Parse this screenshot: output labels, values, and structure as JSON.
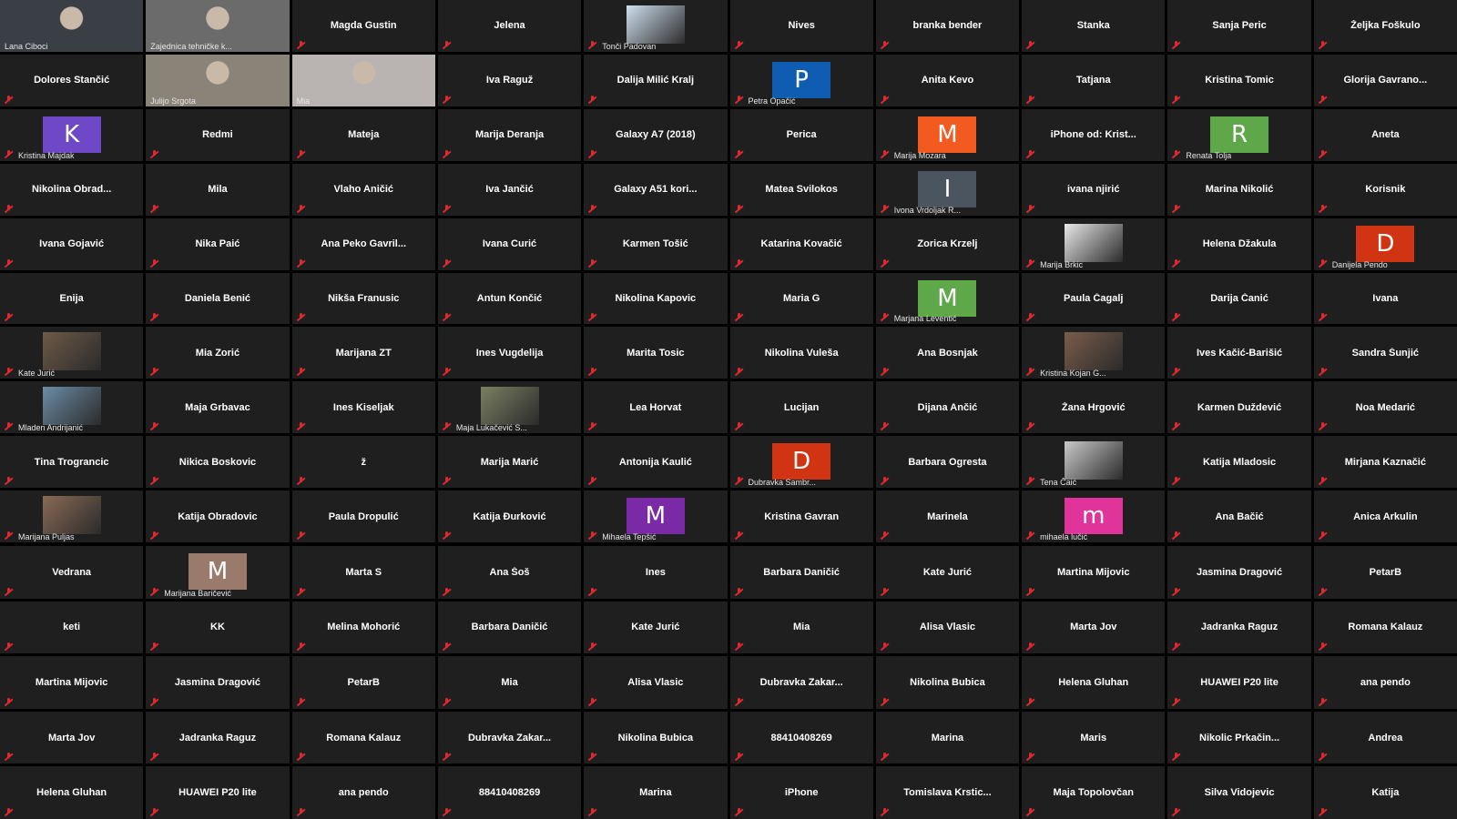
{
  "active_speaker_color": "#d5e87a",
  "muted_icon_color": "#e0282e",
  "tile_color": "#1f1f1f",
  "gallery_pages": [
    [
      {
        "type": "video",
        "caption": "Lana Ciboci",
        "bg": "#3a3f45",
        "active": true
      },
      {
        "type": "video",
        "caption": "Zajednica tehničke k...",
        "bg": "#6b6b6b"
      },
      {
        "type": "name",
        "label": "Magda Gustin"
      },
      {
        "type": "name",
        "label": "Jelena"
      },
      {
        "type": "thumb",
        "caption": "Tonči Padovan",
        "thumb": "world-map-image",
        "bg": "#cfe0ef"
      },
      {
        "type": "name",
        "label": "Nives"
      },
      {
        "type": "name",
        "label": "branka bender"
      },
      {
        "type": "name",
        "label": "Stanka"
      },
      {
        "type": "name",
        "label": "Sanja Peric"
      },
      {
        "type": "name",
        "label": "Željka Foškulo"
      },
      {
        "type": "name",
        "label": "Dolores Stančić"
      },
      {
        "type": "video",
        "caption": "Julijo Srgota",
        "bg": "#8a8378"
      },
      {
        "type": "video",
        "caption": "Mia",
        "bg": "#b9b4b1"
      },
      {
        "type": "name",
        "label": "Iva Raguž"
      },
      {
        "type": "name",
        "label": "Dalija Milić Kralj"
      },
      {
        "type": "avatar",
        "letter": "P",
        "color": "#0e5db3",
        "caption": "Petra Opačić"
      },
      {
        "type": "name",
        "label": "Anita Kevo"
      },
      {
        "type": "name",
        "label": "Tatjana"
      },
      {
        "type": "name",
        "label": "Kristina Tomic"
      },
      {
        "type": "name",
        "label": "Glorija  Gavrano..."
      },
      {
        "type": "avatar",
        "letter": "K",
        "color": "#6f48c7",
        "caption": "Kristina Majdak"
      },
      {
        "type": "name",
        "label": "Redmi"
      },
      {
        "type": "name",
        "label": "Mateja"
      },
      {
        "type": "name",
        "label": "Marija Deranja"
      },
      {
        "type": "name",
        "label": "Galaxy A7 (2018)"
      },
      {
        "type": "name",
        "label": "Perica"
      },
      {
        "type": "avatar",
        "letter": "M",
        "color": "#f25a1f",
        "caption": "Marija Mozara"
      },
      {
        "type": "name",
        "label": "iPhone  od:  Krist..."
      },
      {
        "type": "avatar",
        "letter": "R",
        "color": "#5fa84a",
        "caption": "Renata Tolja"
      },
      {
        "type": "name",
        "label": "Aneta"
      },
      {
        "type": "name",
        "label": "Nikolina  Obrad..."
      },
      {
        "type": "name",
        "label": "Mila"
      },
      {
        "type": "name",
        "label": "Vlaho Aničić"
      },
      {
        "type": "name",
        "label": "Iva Jančić"
      },
      {
        "type": "name",
        "label": "Galaxy  A51  kori..."
      },
      {
        "type": "name",
        "label": "Matea Svilokos"
      },
      {
        "type": "avatar",
        "letter": "I",
        "color": "#4a5560",
        "caption": "Ivona Vrdoljak R..."
      },
      {
        "type": "name",
        "label": "ivana njirić"
      },
      {
        "type": "name",
        "label": "Marina Nikolić"
      },
      {
        "type": "name",
        "label": "Korisnik"
      },
      {
        "type": "name",
        "label": "Ivana Gojavić"
      },
      {
        "type": "name",
        "label": "Nika Paić"
      },
      {
        "type": "name",
        "label": "Ana  Peko  Gavril..."
      },
      {
        "type": "name",
        "label": "Ivana Curić"
      },
      {
        "type": "name",
        "label": "Karmen Tošić"
      },
      {
        "type": "name",
        "label": "Katarina Kovačić"
      },
      {
        "type": "name",
        "label": "Zorica Krzelj"
      },
      {
        "type": "thumb",
        "caption": "Marija Brkic",
        "thumb": "cartoon-sketch-image",
        "bg": "#e8e8e8"
      },
      {
        "type": "name",
        "label": "Helena Džakula"
      },
      {
        "type": "avatar",
        "letter": "D",
        "color": "#d03412",
        "caption": "Danijela Pendo"
      },
      {
        "type": "name",
        "label": "Enija"
      },
      {
        "type": "name",
        "label": "Daniela Benić"
      },
      {
        "type": "name",
        "label": "Nikša Franusic"
      },
      {
        "type": "name",
        "label": "Antun Končić"
      },
      {
        "type": "name",
        "label": "Nikolina Kapovic"
      },
      {
        "type": "name",
        "label": "Maria G"
      },
      {
        "type": "avatar",
        "letter": "M",
        "color": "#5fa84a",
        "caption": "Marjana Leventić"
      },
      {
        "type": "name",
        "label": "Paula Čagalj"
      },
      {
        "type": "name",
        "label": "Darija Čanić"
      },
      {
        "type": "name",
        "label": "Ivana"
      },
      {
        "type": "thumb",
        "caption": "Kate Jurić",
        "thumb": "group-photo-image",
        "bg": "#6e5a47"
      },
      {
        "type": "name",
        "label": "Mia Zorić"
      },
      {
        "type": "name",
        "label": "Marijana ZT"
      },
      {
        "type": "name",
        "label": "Ines Vugdelija"
      },
      {
        "type": "name",
        "label": "Marita Tosic"
      },
      {
        "type": "name",
        "label": "Nikolina Vuleša"
      },
      {
        "type": "name",
        "label": "Ana Bosnjak"
      },
      {
        "type": "thumb",
        "caption": "Kristina Kojan G...",
        "thumb": "portrait-photo-image",
        "bg": "#7a5d4a"
      },
      {
        "type": "name",
        "label": "Ives Kačić-Barišić"
      },
      {
        "type": "name",
        "label": "Sandra Šunjić"
      },
      {
        "type": "thumb",
        "caption": "Mladen Andrijanić",
        "thumb": "seaside-photo-image",
        "bg": "#6c8ca6"
      },
      {
        "type": "name",
        "label": "Maja Grbavac"
      },
      {
        "type": "name",
        "label": "Ines Kiseljak"
      },
      {
        "type": "thumb",
        "caption": "Maja Lukačević S...",
        "thumb": "forest-road-image",
        "bg": "#7b8061"
      },
      {
        "type": "name",
        "label": "Lea Horvat"
      },
      {
        "type": "name",
        "label": "Lucijan"
      },
      {
        "type": "name",
        "label": "Dijana Ančić"
      },
      {
        "type": "name",
        "label": "Žana Hrgović"
      },
      {
        "type": "name",
        "label": "Karmen Duždević"
      },
      {
        "type": "name",
        "label": "Noa Medarić"
      },
      {
        "type": "name",
        "label": "Tina Trograncic"
      },
      {
        "type": "name",
        "label": "Nikica Boskovic"
      },
      {
        "type": "name",
        "label": "ž"
      },
      {
        "type": "name",
        "label": "Marija Marić"
      },
      {
        "type": "name",
        "label": "Antonija Kaulić"
      },
      {
        "type": "avatar",
        "letter": "D",
        "color": "#d03412",
        "caption": "Dubravka Sambr..."
      },
      {
        "type": "name",
        "label": "Barbara Ogresta"
      },
      {
        "type": "thumb",
        "caption": "Tena Čaić",
        "thumb": "portrait-photo-image",
        "bg": "#c9c9c9"
      },
      {
        "type": "name",
        "label": "Katija Mladosic"
      },
      {
        "type": "name",
        "label": "Mirjana Kaznačić"
      },
      {
        "type": "thumb",
        "caption": "Marijana Puljas",
        "thumb": "portrait-photo-image",
        "bg": "#8a6a55"
      },
      {
        "type": "name",
        "label": "Katija Obradovic"
      },
      {
        "type": "name",
        "label": "Paula Dropulić"
      },
      {
        "type": "name",
        "label": "Katija Đurković"
      },
      {
        "type": "avatar",
        "letter": "M",
        "color": "#7a2aa6",
        "caption": "Mihaela Tepšić"
      },
      {
        "type": "name",
        "label": "Kristina Gavran"
      },
      {
        "type": "name",
        "label": "Marinela"
      },
      {
        "type": "avatar",
        "letter": "m",
        "color": "#e0349a",
        "caption": "mihaela lučić"
      },
      {
        "type": "name",
        "label": "Ana Bačić"
      },
      {
        "type": "name",
        "label": "Anica Arkulin"
      }
    ],
    [
      {
        "type": "name",
        "label": "Vedrana"
      },
      {
        "type": "avatar",
        "letter": "M",
        "color": "#9a7a6a",
        "caption": "Marijana Baričević"
      },
      {
        "type": "name",
        "label": "Marta S"
      },
      {
        "type": "name",
        "label": "Ana Šoš"
      },
      {
        "type": "name",
        "label": "Ines"
      },
      {
        "type": "name",
        "label": "Barbara Daničić"
      },
      {
        "type": "name",
        "label": "Kate Jurić"
      },
      {
        "type": "name",
        "label": "Martina Mijovic"
      },
      {
        "type": "name",
        "label": "Jasmina Dragović"
      },
      {
        "type": "name",
        "label": "PetarB"
      },
      {
        "type": "name",
        "label": "keti"
      },
      {
        "type": "name",
        "label": "KK"
      },
      {
        "type": "name",
        "label": "Melina Mohorić"
      },
      {
        "type": "name",
        "label": "Barbara Daničić"
      },
      {
        "type": "name",
        "label": "Kate Jurić"
      },
      {
        "type": "name",
        "label": "Mia"
      },
      {
        "type": "name",
        "label": "Alisa Vlasic"
      },
      {
        "type": "name",
        "label": "Marta Jov"
      },
      {
        "type": "name",
        "label": "Jadranka Raguz"
      },
      {
        "type": "name",
        "label": "Romana Kalauz"
      },
      {
        "type": "name",
        "label": "Martina Mijovic"
      },
      {
        "type": "name",
        "label": "Jasmina Dragović"
      },
      {
        "type": "name",
        "label": "PetarB"
      },
      {
        "type": "name",
        "label": "Mia"
      },
      {
        "type": "name",
        "label": "Alisa Vlasic"
      },
      {
        "type": "name",
        "label": "Dubravka  Zakar..."
      },
      {
        "type": "name",
        "label": "Nikolina Bubica"
      },
      {
        "type": "name",
        "label": "Helena Gluhan"
      },
      {
        "type": "name",
        "label": "HUAWEI P20 lite"
      },
      {
        "type": "name",
        "label": "ana pendo"
      },
      {
        "type": "name",
        "label": "Marta Jov"
      },
      {
        "type": "name",
        "label": "Jadranka Raguz"
      },
      {
        "type": "name",
        "label": "Romana Kalauz"
      },
      {
        "type": "name",
        "label": "Dubravka  Zakar..."
      },
      {
        "type": "name",
        "label": "Nikolina Bubica"
      },
      {
        "type": "name",
        "label": "88410408269"
      },
      {
        "type": "name",
        "label": "Marina"
      },
      {
        "type": "name",
        "label": "Maris"
      },
      {
        "type": "name",
        "label": "Nikolic  Prkačin..."
      },
      {
        "type": "name",
        "label": "Andrea"
      },
      {
        "type": "name",
        "label": "Helena Gluhan"
      },
      {
        "type": "name",
        "label": "HUAWEI P20 lite"
      },
      {
        "type": "name",
        "label": "ana pendo"
      },
      {
        "type": "name",
        "label": "88410408269"
      },
      {
        "type": "name",
        "label": "Marina"
      },
      {
        "type": "name",
        "label": "iPhone"
      },
      {
        "type": "name",
        "label": "Tomislava  Krstic..."
      },
      {
        "type": "name",
        "label": "Maja Topolovčan"
      },
      {
        "type": "name",
        "label": "Silva Vidojevic"
      },
      {
        "type": "name",
        "label": "Katija"
      }
    ]
  ]
}
